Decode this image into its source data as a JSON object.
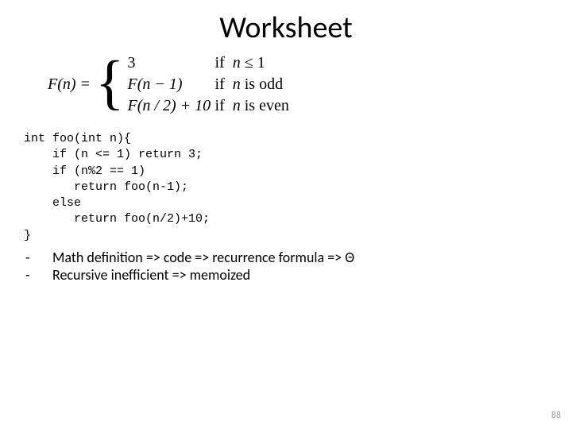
{
  "title": "Worksheet",
  "formula": {
    "lhs": "F(n) =",
    "cases": [
      {
        "expr_html": "<span class='num'>3</span>",
        "cond_html": "if&nbsp; <span class='var'>n</span> ≤ 1"
      },
      {
        "expr_html": "<span class='var'>F</span>(<span class='var'>n</span> − 1)",
        "cond_html": "if&nbsp; <span class='var'>n</span> is odd"
      },
      {
        "expr_html": "<span class='var'>F</span>(<span class='var'>n</span> / 2) + 10",
        "cond_html": "if&nbsp; <span class='var'>n</span> is even"
      }
    ]
  },
  "code": "int foo(int n){\n    if (n <= 1) return 3;\n    if (n%2 == 1)\n       return foo(n-1);\n    else\n       return foo(n/2)+10;\n}",
  "bullets": [
    "Math definition => code => recurrence formula => Θ",
    "Recursive inefficient => memoized"
  ],
  "page_number": "88"
}
